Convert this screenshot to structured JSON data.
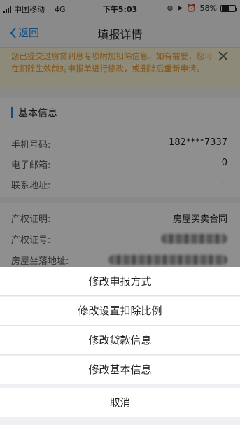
{
  "status_bar": {
    "carrier": "中国移动",
    "network": "4G",
    "time": "下午5:03",
    "battery": "58%",
    "battery_level": 0.58
  },
  "nav": {
    "back_label": "返回",
    "title": "填报详情"
  },
  "notice": {
    "text": "您已提交过房贷利息专项附加扣除信息，如有需要，您可在扣除生效前对申报单进行修改，或删除后重新申请。"
  },
  "basic_info": {
    "title": "基本信息",
    "rows": [
      {
        "label": "手机号码:",
        "value": "182****7337"
      },
      {
        "label": "电子邮箱:",
        "value": "0"
      },
      {
        "label": "联系地址:",
        "value": "--"
      }
    ]
  },
  "property": {
    "rows": [
      {
        "label": "产权证明:",
        "value": "房屋买卖合同"
      },
      {
        "label": "产权证号:",
        "value": ""
      },
      {
        "label": "房屋坐落地址:",
        "value": ""
      }
    ]
  },
  "action_sheet": {
    "items": [
      "修改申报方式",
      "修改设置扣除比例",
      "修改贷款信息",
      "修改基本信息"
    ],
    "cancel": "取消"
  },
  "colors": {
    "accent": "#1e88e5",
    "notice_text": "#e8962c",
    "notice_bg": "#fdf6d9"
  }
}
